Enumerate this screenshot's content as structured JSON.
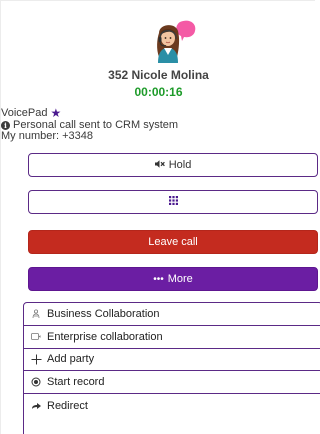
{
  "contact": {
    "name": "352 Nicole Molina",
    "timer": "00:00:16"
  },
  "info": {
    "app_name": "VoicePad",
    "status_message": "Personal call sent to CRM system",
    "my_number": "My number: +3348"
  },
  "controls": {
    "hold_label": "Hold",
    "leave_label": "Leave call",
    "more_label": "More"
  },
  "menu": {
    "items": [
      {
        "label": "Business Collaboration",
        "icon": "group-icon"
      },
      {
        "label": "Enterprise collaboration",
        "icon": "window-icon"
      },
      {
        "label": "Add party",
        "icon": "plus-icon"
      },
      {
        "label": "Start record",
        "icon": "record-icon"
      },
      {
        "label": "Redirect",
        "icon": "redirect-arrow-icon"
      }
    ]
  },
  "colors": {
    "accent": "#6b1ea3",
    "leave": "#c42b1f",
    "timer": "#1e9b2a"
  }
}
